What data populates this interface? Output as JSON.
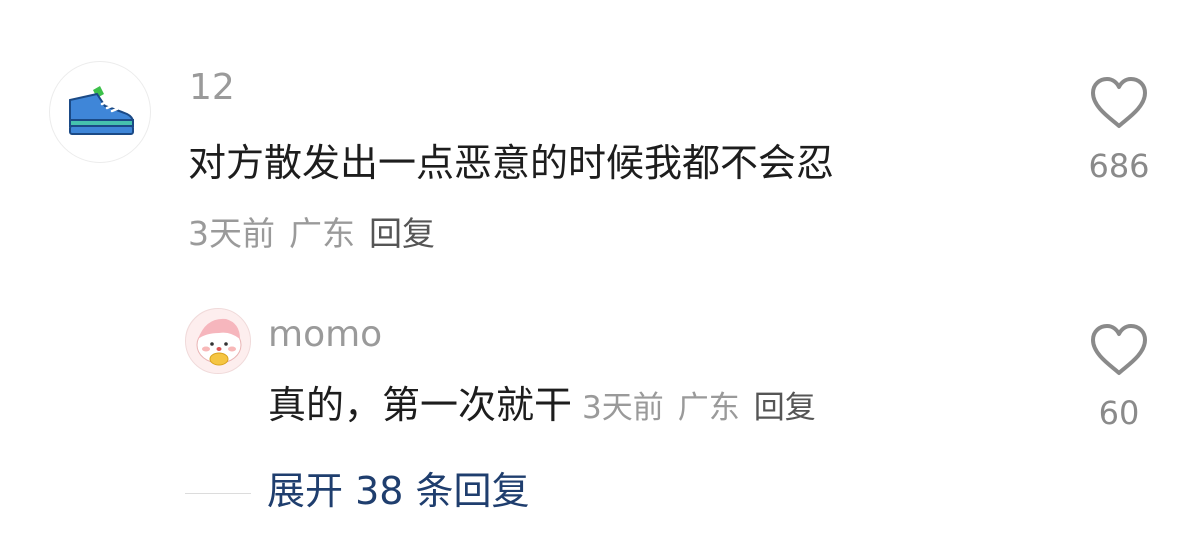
{
  "comment": {
    "username": "12",
    "text": "对方散发出一点恶意的时候我都不会忍",
    "time": "3天前",
    "location": "广东",
    "reply_label": "回复",
    "likes": "686",
    "avatar_icon": "sneaker-icon"
  },
  "reply": {
    "username": "momo",
    "text": "真的，第一次就干",
    "time": "3天前",
    "location": "广东",
    "reply_label": "回复",
    "likes": "60",
    "avatar_icon": "cartoon-avatar-icon"
  },
  "expand": {
    "label": "展开 38 条回复"
  },
  "colors": {
    "expand_link": "#1f3e6e",
    "meta_gray": "#9a9a9a",
    "heart_stroke": "#8a8a8a"
  }
}
